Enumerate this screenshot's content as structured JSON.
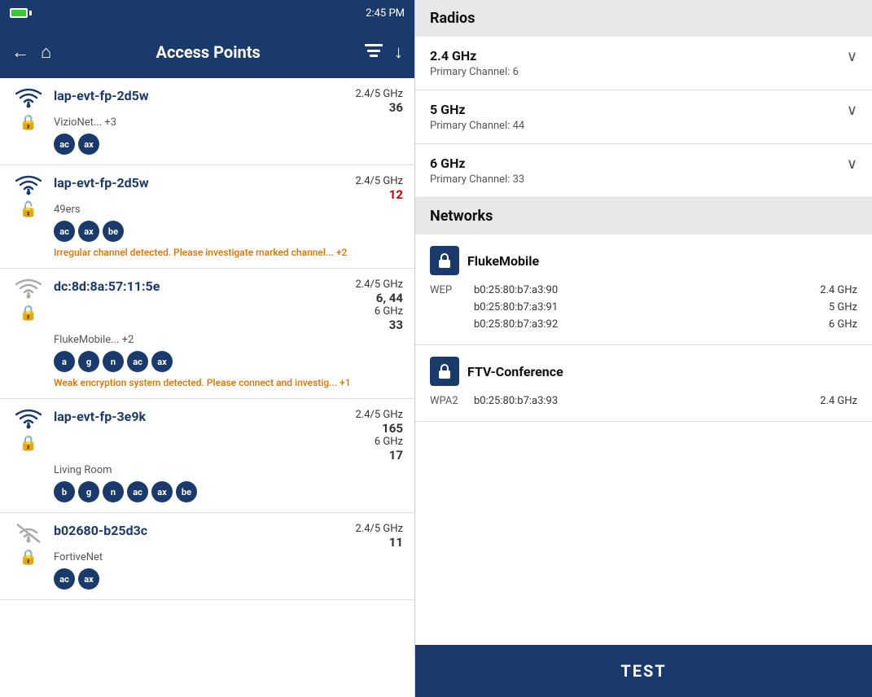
{
  "status_bar": {
    "time": "2:45 PM"
  },
  "toolbar": {
    "title": "Access Points",
    "back_label": "←",
    "home_label": "⌂",
    "filter_label": "≡",
    "sort_label": "↓"
  },
  "access_points": [
    {
      "id": "ap1",
      "name": "lap-evt-fp-2d5w",
      "location": "VizioNet... +3",
      "freq": "2.4/5 GHz",
      "channel": "36",
      "channel_red": false,
      "wifi_active": true,
      "locked": true,
      "badges": [
        "ac",
        "ax"
      ],
      "warning": null
    },
    {
      "id": "ap2",
      "name": "lap-evt-fp-2d5w",
      "location": "49ers",
      "freq": "2.4/5 GHz",
      "channel": "12",
      "channel_red": true,
      "wifi_active": true,
      "locked": false,
      "badges": [
        "ac",
        "ax",
        "be"
      ],
      "warning": "Irregular channel detected. Please investigate marked channel... +2"
    },
    {
      "id": "ap3",
      "name": "dc:8d:8a:57:11:5e",
      "location": "FlukeMobile... +2",
      "freq1": "2.4/5 GHz",
      "channels1": "6, 44",
      "freq2": "6 GHz",
      "channel2": "33",
      "wifi_active": false,
      "locked": true,
      "badges": [
        "a",
        "g",
        "n",
        "ac",
        "ax"
      ],
      "warning": "Weak encryption system detected. Please connect and investig... +1"
    },
    {
      "id": "ap4",
      "name": "lap-evt-fp-3e9k",
      "location": "Living Room",
      "freq": "2.4/5 GHz",
      "channel": "165",
      "freq2": "6 GHz",
      "channel2": "17",
      "wifi_active": true,
      "locked": true,
      "badges": [
        "b",
        "g",
        "n",
        "ac",
        "ax",
        "be"
      ],
      "warning": null
    },
    {
      "id": "ap5",
      "name": "b02680-b25d3c",
      "location": "FortiveNet",
      "freq": "2.4/5 GHz",
      "channel": "11",
      "wifi_active": false,
      "no_wifi": true,
      "locked": true,
      "badges": [
        "ac",
        "ax"
      ],
      "warning": null
    }
  ],
  "radios": {
    "section_title": "Radios",
    "items": [
      {
        "name": "2.4 GHz",
        "channel_label": "Primary Channel: 6"
      },
      {
        "name": "5 GHz",
        "channel_label": "Primary Channel: 44"
      },
      {
        "name": "6 GHz",
        "channel_label": "Primary Channel: 33"
      }
    ]
  },
  "networks": {
    "section_title": "Networks",
    "items": [
      {
        "name": "FlukeMobile",
        "icon": "🔒",
        "enc_label": "WEP",
        "rows": [
          {
            "mac": "b0:25:80:b7:a3:90",
            "band": "2.4 GHz"
          },
          {
            "mac": "b0:25:80:b7:a3:91",
            "band": "5 GHz"
          },
          {
            "mac": "b0:25:80:b7:a3:92",
            "band": "6 GHz"
          }
        ]
      },
      {
        "name": "FTV-Conference",
        "icon": "🔒",
        "enc_label": "WPA2",
        "rows": [
          {
            "mac": "b0:25:80:b7:a3:93",
            "band": "2.4 GHz"
          }
        ]
      }
    ]
  },
  "test_button_label": "TEST"
}
